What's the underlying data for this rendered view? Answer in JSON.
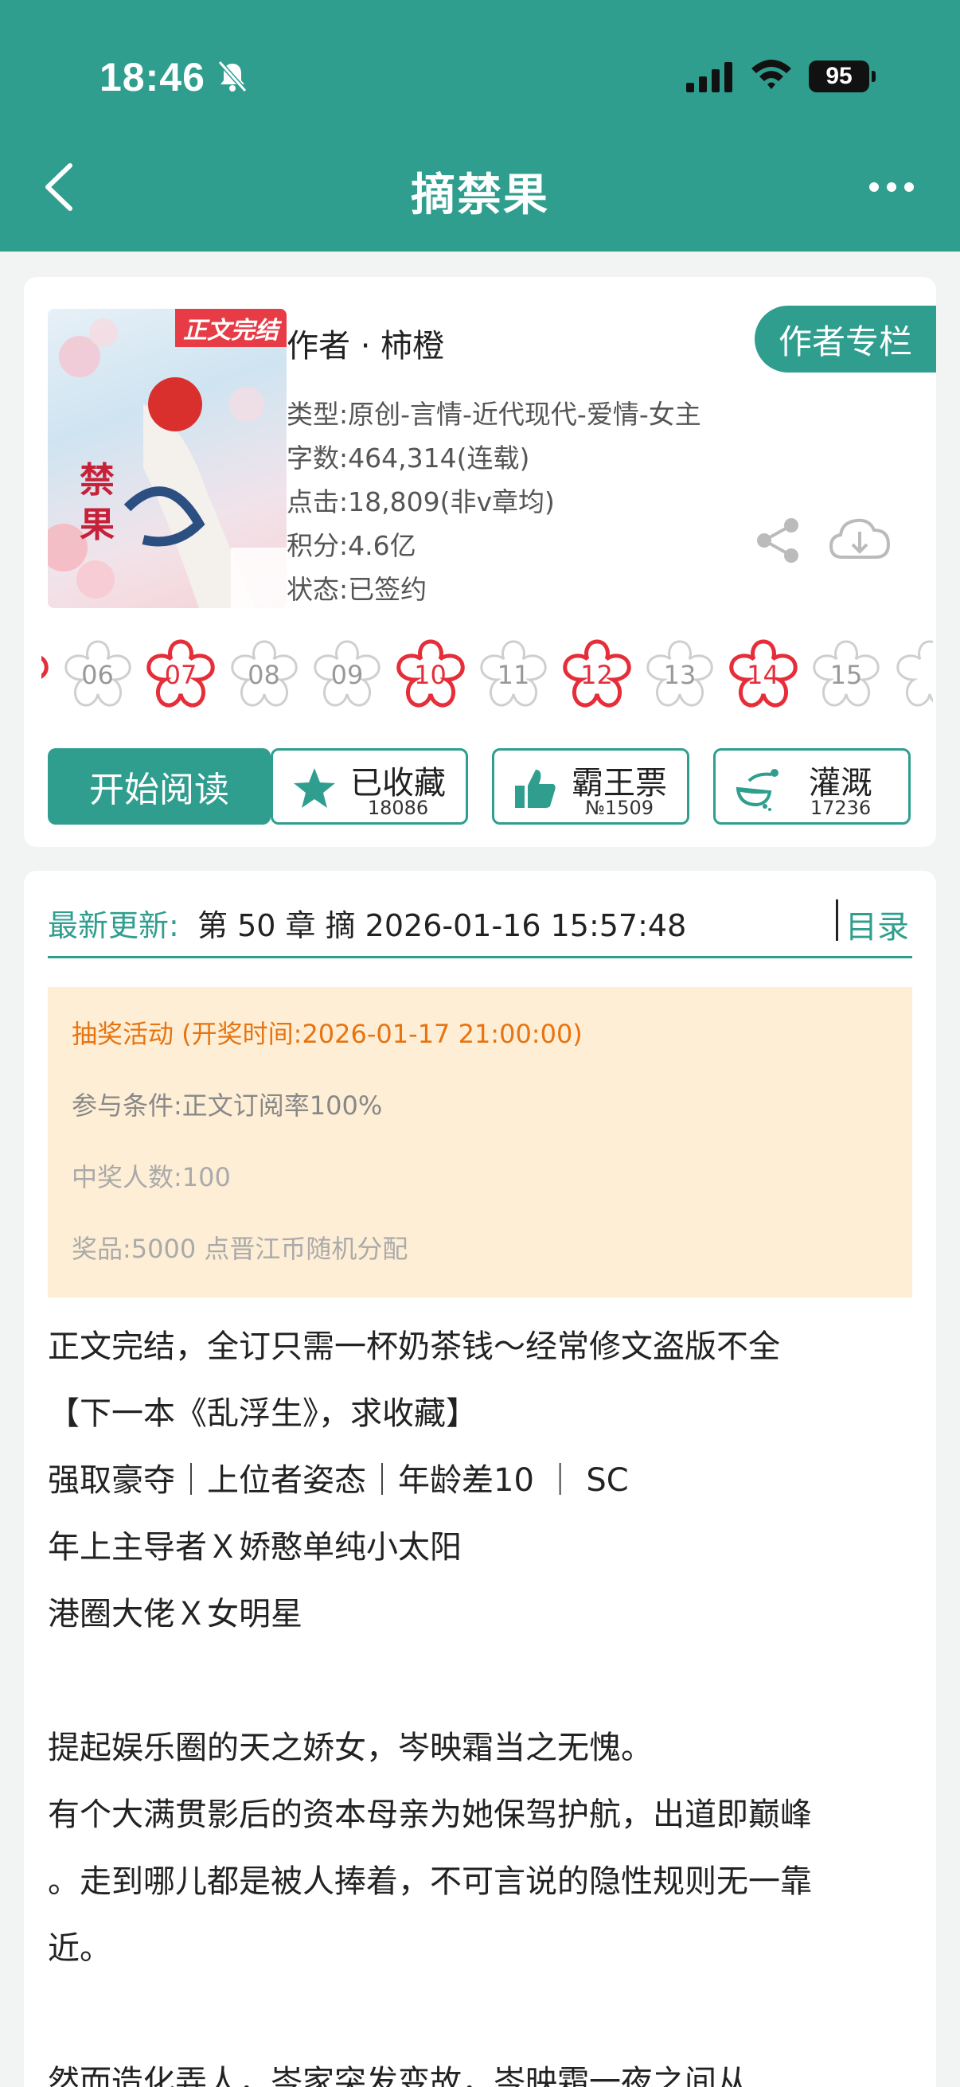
{
  "status_bar": {
    "time": "18:46",
    "battery": "95"
  },
  "header": {
    "title": "摘禁果"
  },
  "book": {
    "cover_badge": "正文完结",
    "cover_title_chars": "禁果",
    "author": "作者 · 柿橙",
    "author_column_button": "作者专栏",
    "type": "类型:原创-言情-近代现代-爱情-女主",
    "word_count": "字数:464,314(连载)",
    "clicks": "点击:18,809(非v章均)",
    "score": "积分:4.6亿",
    "status": "状态:已签约"
  },
  "calendar_days": [
    {
      "day": "06",
      "active": false
    },
    {
      "day": "07",
      "active": true
    },
    {
      "day": "08",
      "active": false
    },
    {
      "day": "09",
      "active": false
    },
    {
      "day": "10",
      "active": true
    },
    {
      "day": "11",
      "active": false
    },
    {
      "day": "12",
      "active": true
    },
    {
      "day": "13",
      "active": false
    },
    {
      "day": "14",
      "active": true
    },
    {
      "day": "15",
      "active": false
    }
  ],
  "actions": {
    "read": "开始阅读",
    "collect": {
      "label": "已收藏",
      "count": "18086"
    },
    "ticket": {
      "label": "霸王票",
      "count": "№1509"
    },
    "water": {
      "label": "灌溉",
      "count": "17236"
    }
  },
  "update": {
    "label": "最新更新:",
    "text": "第 50 章 摘 2026-01-16 15:57:48",
    "toc": "目录"
  },
  "lottery": {
    "title": "抽奖活动 (开奖时间:2026-01-17 21:00:00)",
    "condition": "参与条件:正文订阅率100%",
    "winners": "中奖人数:100",
    "prize": "奖品:5000 点晋江币随机分配"
  },
  "description": [
    "正文完结，全订只需一杯奶茶钱～经常修文盗版不全",
    "【下一本《乱浮生》，求收藏】",
    "强取豪夺｜上位者姿态｜年龄差10 ｜ SC",
    "年上主导者Ｘ娇憨单纯小太阳",
    "港圈大佬Ｘ女明星",
    "",
    "提起娱乐圈的天之娇女，岑映霜当之无愧。",
    "有个大满贯影后的资本母亲为她保驾护航，出道即巅峰",
    "。走到哪儿都是被人捧着，不可言说的隐性规则无一靠",
    "近。",
    "",
    "然而造化弄人，岑家突发变故，岑映霜一夜之间从"
  ],
  "colors": {
    "primary": "#2f9e8f",
    "red": "#e52e3a",
    "lottery_bg": "#feeed5",
    "lottery_title": "#e8730f"
  },
  "icons": [
    "back-icon",
    "more-icon",
    "share-icon",
    "download-icon",
    "star-icon",
    "thumbs-up-icon",
    "watering-can-icon",
    "bell-off-icon",
    "signal-icon",
    "wifi-icon"
  ]
}
